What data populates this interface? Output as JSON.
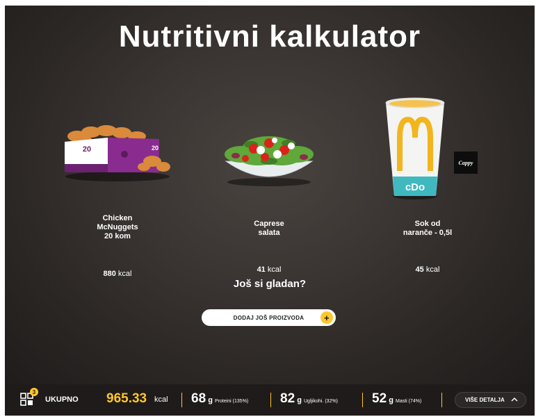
{
  "title": "Nutritivni kalkulator",
  "products": [
    {
      "name_lines": [
        "Chicken",
        "McNuggets",
        "20 kom"
      ],
      "kcal": "880",
      "kcal_unit": "kcal",
      "image": "nuggets-box-image"
    },
    {
      "name_lines": [
        "Caprese",
        "salata"
      ],
      "kcal": "41",
      "kcal_unit": "kcal",
      "image": "salad-bowl-image"
    },
    {
      "name_lines": [
        "Sok od",
        "naranče - 0,5l"
      ],
      "kcal": "45",
      "kcal_unit": "kcal",
      "image": "cup-image",
      "brand_logo": "Cappy"
    }
  ],
  "hungry_text": "Još si gladan?",
  "add_button": {
    "label": "DODAJ JOŠ PROIZVODA",
    "icon": "plus-icon"
  },
  "footer": {
    "tray_count": "3",
    "total_label": "UKUPNO",
    "total_value": "965.33",
    "total_unit": "kcal",
    "macros": [
      {
        "value": "68",
        "unit": "g",
        "label": "Proteini (135%)"
      },
      {
        "value": "82",
        "unit": "g",
        "label": "Ugljikohi. (32%)"
      },
      {
        "value": "52",
        "unit": "g",
        "label": "Masti (74%)"
      }
    ],
    "details_label": "VIŠE DETALJA"
  },
  "colors": {
    "accent": "#ffc72c",
    "background": "#2b2725",
    "footer": "#1f1b1a",
    "mcd_red": "#da291c"
  }
}
